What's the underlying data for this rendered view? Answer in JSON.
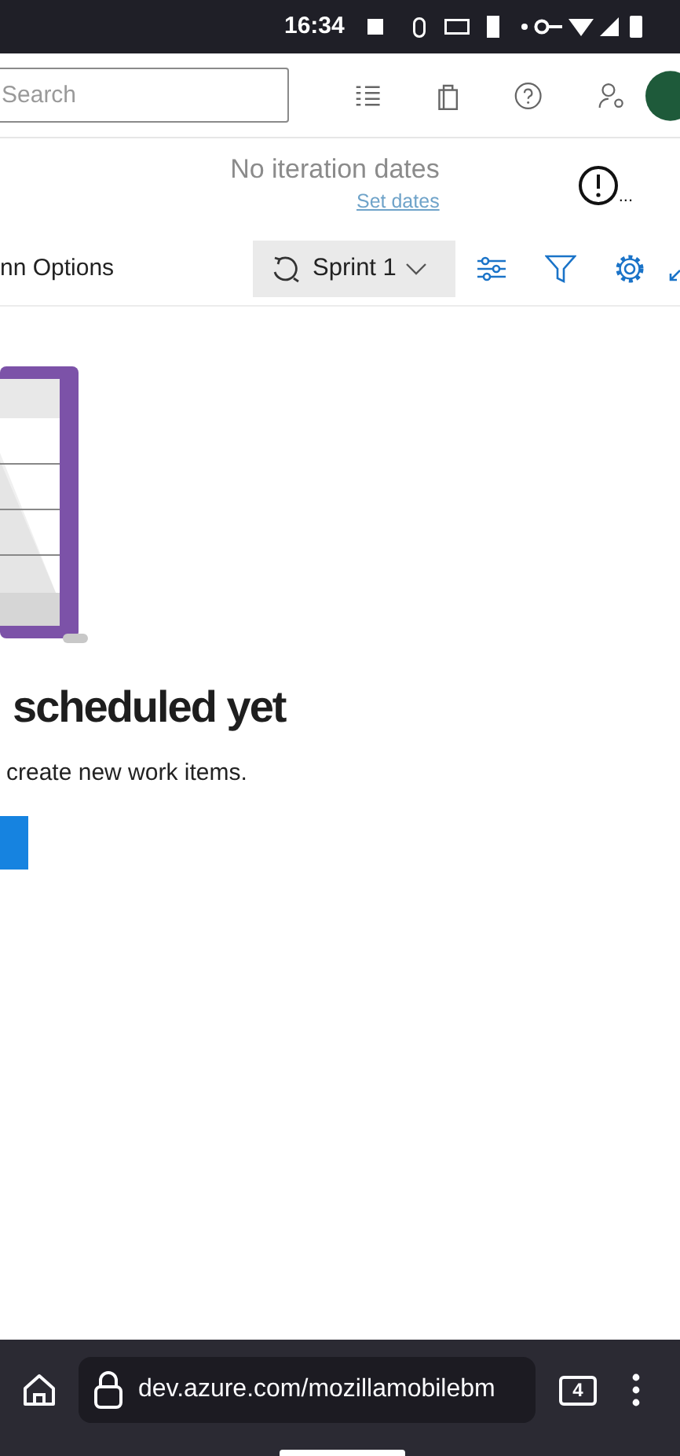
{
  "status_bar": {
    "time": "16:34"
  },
  "header": {
    "search": {
      "placeholder": "Search"
    }
  },
  "iteration": {
    "dates": "No iteration dates",
    "set_dates": "Set dates",
    "more": "..."
  },
  "toolbar": {
    "column_options": "nn Options",
    "sprint": "Sprint 1"
  },
  "empty_state": {
    "title": "scheduled yet",
    "text": "create new work items."
  },
  "browser": {
    "url": "dev.azure.com/mozillamobilebm",
    "tab_count": "4"
  }
}
